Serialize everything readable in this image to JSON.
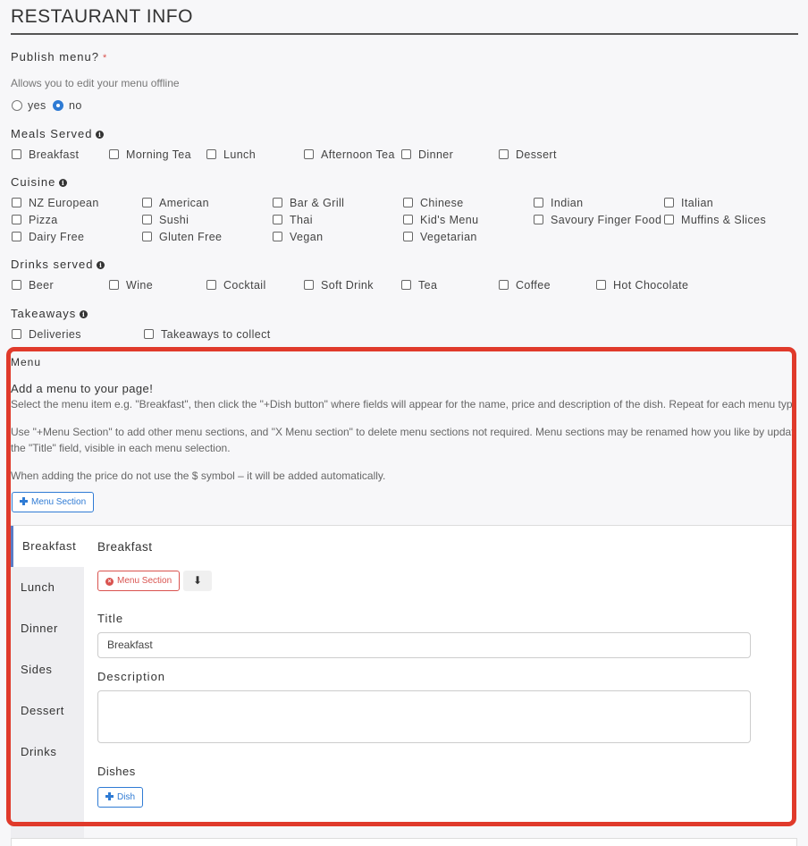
{
  "header": {
    "title": "RESTAURANT INFO"
  },
  "publish": {
    "label": "Publish menu?",
    "required_mark": "*",
    "help": "Allows you to edit your menu offline",
    "options": [
      {
        "label": "yes",
        "selected": false
      },
      {
        "label": "no",
        "selected": true
      }
    ]
  },
  "meals": {
    "label": "Meals Served",
    "options": [
      "Breakfast",
      "Morning Tea",
      "Lunch",
      "Afternoon Tea",
      "Dinner",
      "Dessert"
    ]
  },
  "cuisine": {
    "label": "Cuisine",
    "options": [
      "NZ European",
      "American",
      "Bar & Grill",
      "Chinese",
      "Indian",
      "Italian",
      "Pizza",
      "Sushi",
      "Thai",
      "Kid's Menu",
      "Savoury Finger Food",
      "Muffins & Slices",
      "Dairy Free",
      "Gluten Free",
      "Vegan",
      "Vegetarian"
    ]
  },
  "drinks": {
    "label": "Drinks served",
    "options": [
      "Beer",
      "Wine",
      "Cocktail",
      "Soft Drink",
      "Tea",
      "Coffee",
      "Hot Chocolate"
    ]
  },
  "takeaways": {
    "label": "Takeaways",
    "options": [
      "Deliveries",
      "Takeaways to collect"
    ]
  },
  "menu": {
    "heading": "Menu",
    "add_heading": "Add a menu to your page!",
    "para1": "Select the menu item e.g. \"Breakfast\", then click the \"+Dish button\" where fields will appear for the name, price and description of the dish. Repeat for each menu type.",
    "para2a": "Use \"+Menu Section\" to add other menu sections, and \"X Menu section\" to delete menu sections not required. Menu sections may be renamed how you like by updating",
    "para2b": "the \"Title\" field, visible in each menu selection.",
    "para3": "When adding the price do not use the $ symbol – it will be added automatically.",
    "add_section_label": "Menu Section",
    "tabs": [
      "Breakfast",
      "Lunch",
      "Dinner",
      "Sides",
      "Dessert",
      "Drinks"
    ],
    "active_tab": "Breakfast",
    "section": {
      "heading": "Breakfast",
      "remove_label": "Menu Section",
      "title_label": "Title",
      "title_value": "Breakfast",
      "description_label": "Description",
      "description_value": "",
      "dishes_label": "Dishes",
      "add_dish_label": "Dish"
    }
  },
  "colors": {
    "accent": "#2f7bd4",
    "danger": "#d9534f",
    "highlight": "#e03a2b"
  },
  "icons": [
    "info-icon",
    "plus-icon",
    "x-circle-icon",
    "arrow-down-icon"
  ]
}
